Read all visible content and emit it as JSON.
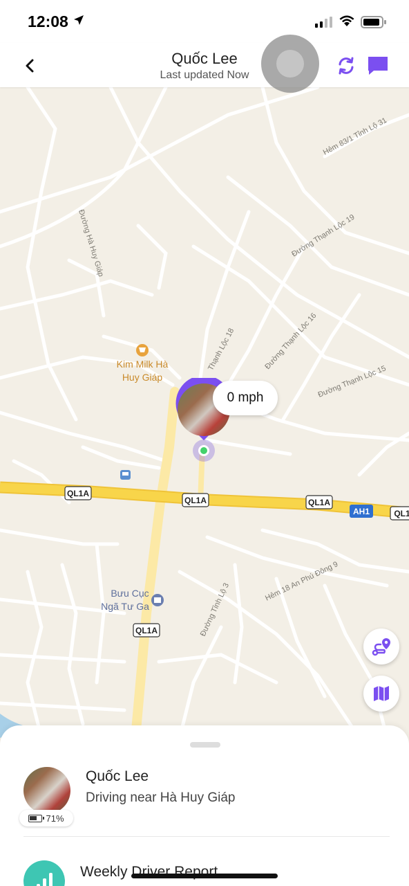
{
  "status_bar": {
    "time": "12:08",
    "icons": [
      "location-arrow-icon",
      "signal-icon",
      "wifi-icon",
      "battery-icon"
    ]
  },
  "header": {
    "title": "Quốc Lee",
    "subtitle": "Last updated Now",
    "icons": [
      "chevron-left-icon",
      "refresh-icon",
      "chat-icon"
    ],
    "accent_color": "#7b4ff0"
  },
  "map": {
    "street_labels": [
      "Hẻm 83/1 Tỉnh Lộ 31",
      "Đường Hà Huy Giáp",
      "Đường Thạnh Lộc 19",
      "Thạnh Lộc 18",
      "Đường Thạnh Lộc 16",
      "Đường Thạnh Lộc 15",
      "Hẻm 18 An Phú Đông 9",
      "Đường Tỉnh Lộ 3"
    ],
    "poi_kim_milk": [
      "Kim Milk Hà",
      "Huy Giáp"
    ],
    "poi_buu_cuc": [
      "Bưu Cục",
      "Ngã Tư Ga"
    ],
    "shields": [
      "QL1A",
      "QL1A",
      "QL1A",
      "AH1",
      "QL1",
      "QL1A"
    ],
    "speed": "0 mph",
    "poi_colors": {
      "shop": "#e8a33d",
      "post": "#6b7fb0",
      "bus": "#5a8fd0"
    }
  },
  "fabs": {
    "route_icon": "route-pin-icon",
    "map_icon": "map-icon"
  },
  "sheet": {
    "member_name": "Quốc Lee",
    "member_status": "Driving near Hà Huy Giáp",
    "battery": "71%",
    "report_title": "Weekly Driver Report",
    "report_icon_color": "#3ec6b3"
  }
}
